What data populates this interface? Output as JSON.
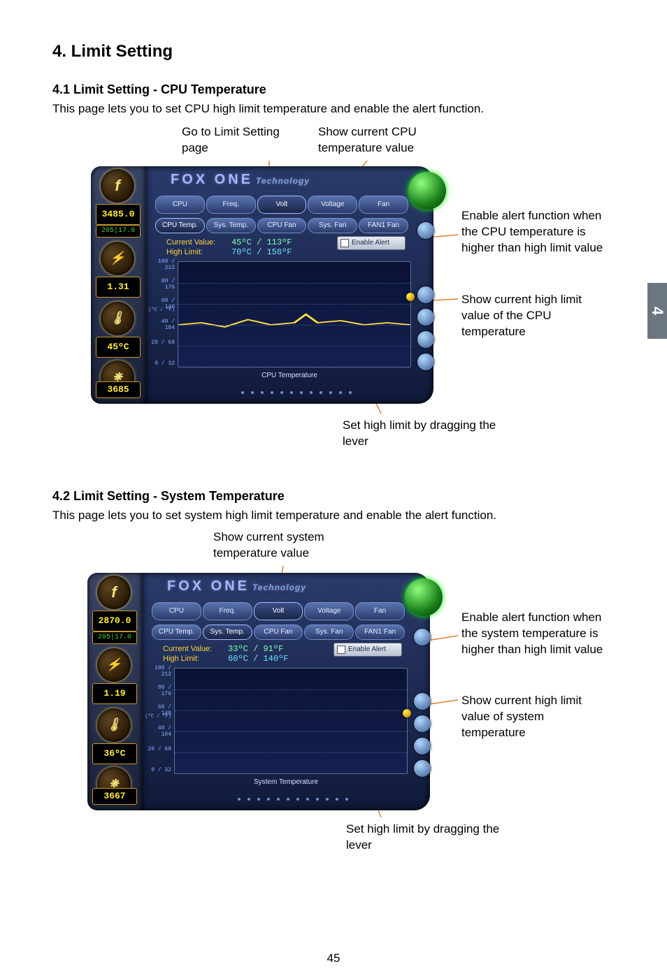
{
  "side_tab": "4",
  "page_number": "45",
  "heading": "4. Limit Setting",
  "sections": [
    {
      "title": "4.1 Limit Setting - CPU Temperature",
      "intro": "This page lets you to set CPU high limit temperature and enable the alert function.",
      "callouts": {
        "top_left": "Go to Limit Setting page",
        "top_right": "Show current CPU temperature value",
        "right1": "Enable alert function when the CPU temperature is higher than high limit value",
        "right2": "Show current high limit value of the CPU temperature",
        "bottom": "Set high limit by dragging the lever"
      },
      "widget": {
        "brand": "FOX ONE",
        "brand_tag": "Technology",
        "tabs1": [
          "CPU",
          "Freq.",
          "Volt",
          "Voltage",
          "Fan"
        ],
        "tabs2": [
          "CPU Temp.",
          "Sys. Temp.",
          "CPU Fan",
          "Sys. Fan",
          "FAN1 Fan"
        ],
        "active_tab2": 0,
        "current_value_label": "Current Value:",
        "current_value": "45ºC / 113ºF",
        "high_limit_label": "High Limit:",
        "high_limit": "70ºC / 158ºF",
        "enable_label": "Enable Alert",
        "chart_title": "CPU Temperature",
        "y_ticks": [
          "109 / 212",
          "80 / 176",
          "60 / 140",
          "40 / 104",
          "20 / 68",
          "0 / 32"
        ],
        "y_unit": "(ºC / ºF)",
        "left_meters": {
          "mhz": "3485.0",
          "fsb": "205|17.0",
          "volt": "1.31",
          "temp": "45ºC",
          "fan": "3685"
        }
      }
    },
    {
      "title": "4.2 Limit Setting - System Temperature",
      "intro": "This page lets you to set system high limit temperature and enable the alert function.",
      "callouts": {
        "top": "Show current system temperature value",
        "right1": "Enable alert function when the system temperature is higher than high limit value",
        "right2": "Show current high limit value of system temperature",
        "bottom": "Set high limit by dragging the lever"
      },
      "widget": {
        "brand": "FOX ONE",
        "brand_tag": "Technology",
        "tabs1": [
          "CPU",
          "Freq.",
          "Volt",
          "Voltage",
          "Fan"
        ],
        "tabs2": [
          "CPU Temp.",
          "Sys. Temp.",
          "CPU Fan",
          "Sys. Fan",
          "FAN1 Fan"
        ],
        "active_tab2": 1,
        "current_value_label": "Current Value:",
        "current_value": "33ºC / 91ºF",
        "high_limit_label": "High Limit:",
        "high_limit": "60ºC / 140ºF",
        "enable_label": "Enable Alert",
        "chart_title": "System Temperature",
        "y_ticks": [
          "100 / 212",
          "80 / 176",
          "60 / 140",
          "40 / 104",
          "20 / 68",
          "0 / 32"
        ],
        "y_unit": "(ºC / ºF)",
        "left_meters": {
          "mhz": "2870.0",
          "fsb": "205|17.0",
          "volt": "1.19",
          "temp": "36ºC",
          "fan": "3667"
        }
      }
    }
  ]
}
